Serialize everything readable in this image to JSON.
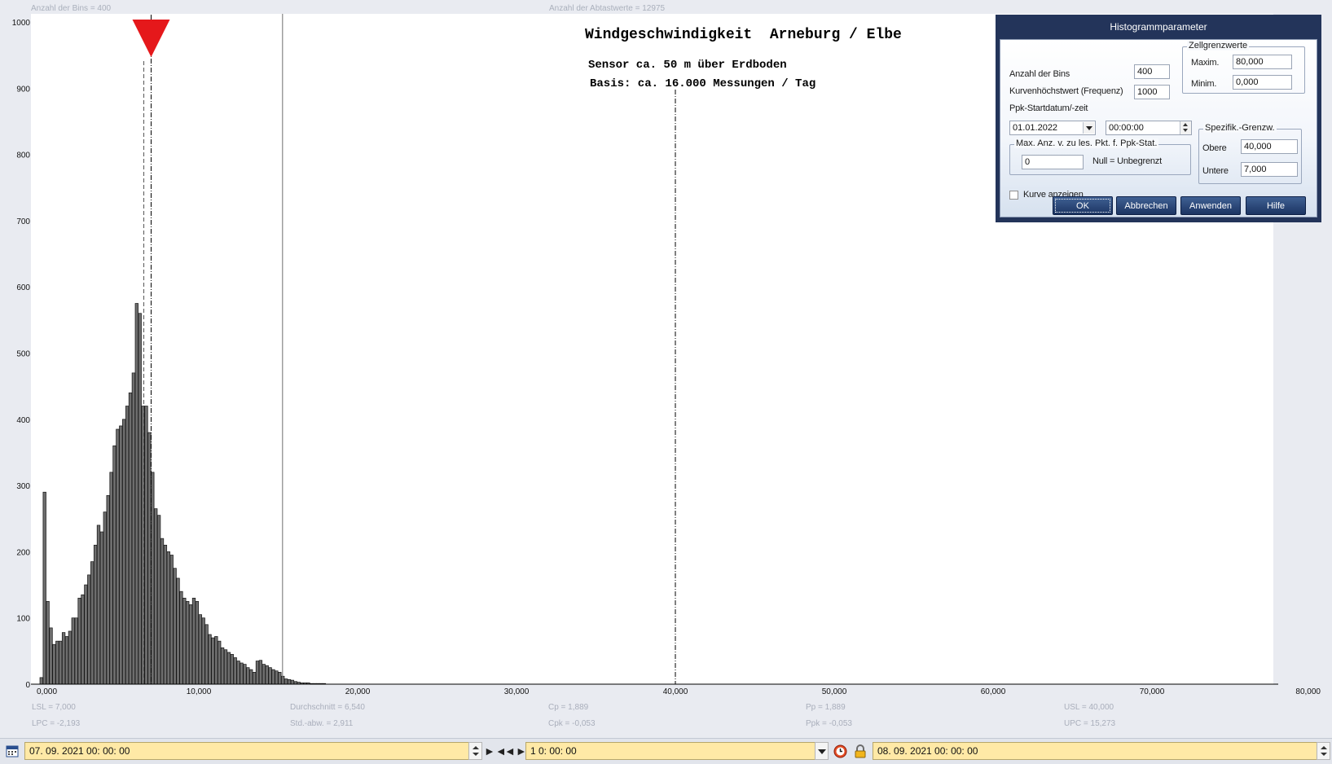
{
  "chart_data": {
    "type": "bar",
    "title": "Windgeschwindigkeit  Arneburg / Elbe",
    "subtitle_lines": [
      "Sensor ca. 50 m über Erdboden",
      "Basis: ca. 16.000 Messungen / Tag"
    ],
    "top_left_info": "Anzahl der Bins =   400",
    "top_center_info": "Anzahl der Abtastwerte = 12975",
    "x_tick_labels": [
      "0,000",
      "10,000",
      "20,000",
      "30,000",
      "40,000",
      "50,000",
      "60,000",
      "70,000",
      "80,000"
    ],
    "x_tick_values": [
      0,
      10,
      20,
      30,
      40,
      50,
      60,
      70,
      80
    ],
    "y_tick_labels": [
      "0",
      "100",
      "200",
      "300",
      "400",
      "500",
      "600",
      "700",
      "800",
      "900",
      "1000"
    ],
    "y_tick_values": [
      0,
      100,
      200,
      300,
      400,
      500,
      600,
      700,
      800,
      900,
      1000
    ],
    "xlim": [
      0,
      80
    ],
    "ylim": [
      0,
      1000
    ],
    "bin_width": 0.2,
    "bin_starts": [
      0.0,
      0.2,
      0.4,
      0.6,
      0.8,
      1.0,
      1.2,
      1.4,
      1.6,
      1.8,
      2.0,
      2.2,
      2.4,
      2.6,
      2.8,
      3.0,
      3.2,
      3.4,
      3.6,
      3.8,
      4.0,
      4.2,
      4.4,
      4.6,
      4.8,
      5.0,
      5.2,
      5.4,
      5.6,
      5.8,
      6.0,
      6.2,
      6.4,
      6.6,
      6.8,
      7.0,
      7.2,
      7.4,
      7.6,
      7.8,
      8.0,
      8.2,
      8.4,
      8.6,
      8.8,
      9.0,
      9.2,
      9.4,
      9.6,
      9.8,
      10.0,
      10.2,
      10.4,
      10.6,
      10.8,
      11.0,
      11.2,
      11.4,
      11.6,
      11.8,
      12.0,
      12.2,
      12.4,
      12.6,
      12.8,
      13.0,
      13.2,
      13.4,
      13.6,
      13.8,
      14.0,
      14.2,
      14.4,
      14.6,
      14.8,
      15.0,
      15.2,
      15.4,
      15.6,
      15.8,
      16.0,
      16.2,
      16.4,
      16.6,
      16.8,
      17.0,
      17.2,
      17.4,
      17.6,
      17.8
    ],
    "values": [
      10,
      290,
      125,
      85,
      60,
      65,
      65,
      78,
      72,
      80,
      100,
      100,
      130,
      135,
      150,
      165,
      185,
      210,
      240,
      230,
      260,
      285,
      320,
      360,
      385,
      390,
      400,
      420,
      440,
      470,
      575,
      560,
      420,
      420,
      380,
      320,
      265,
      255,
      220,
      210,
      200,
      195,
      175,
      160,
      140,
      130,
      125,
      120,
      130,
      125,
      105,
      100,
      90,
      75,
      70,
      72,
      65,
      55,
      52,
      48,
      45,
      40,
      35,
      32,
      30,
      25,
      22,
      18,
      35,
      36,
      30,
      28,
      25,
      22,
      20,
      18,
      12,
      8,
      7,
      6,
      4,
      3,
      2,
      2,
      2,
      1,
      1,
      1,
      1,
      1
    ],
    "mean": 6.54,
    "lsl": 7.0,
    "usl": 40.0,
    "lpc": -2.193,
    "upc": 15.273,
    "grid": false,
    "colors": {
      "bar_fill": "#6e6e6e",
      "bar_edge": "#111111",
      "marker": "#e5181b"
    }
  },
  "stats": {
    "lsl": "LSL = 7,000",
    "lpc": "LPC = -2,193",
    "mean": "Durchschnitt  = 6,540",
    "std": "Std.-abw.  = 2,911",
    "cp": "Cp  = 1,889",
    "cpk": "Cpk = -0,053",
    "pp": "Pp  = 1,889",
    "ppk": "Ppk = -0,053",
    "usl": "USL = 40,000",
    "upc": "UPC = 15,273"
  },
  "dialog": {
    "title": "Histogrammparameter",
    "bins_label": "Anzahl der Bins",
    "bins_value": "400",
    "peak_label": "Kurvenhöchstwert (Frequenz)",
    "peak_value": "1000",
    "start_label": "Ppk-Startdatum/-zeit",
    "start_date": "01.01.2022",
    "start_time": "00:00:00",
    "cell_group": "Zellgrenzwerte",
    "max_label": "Maxim.",
    "max_value": "80,000",
    "min_label": "Minim.",
    "min_value": "0,000",
    "spec_group": "Spezifik.-Grenzw.",
    "upper_label": "Obere",
    "upper_value": "40,000",
    "lower_label": "Untere",
    "lower_value": "7,000",
    "maxpts_group": "Max. Anz. v. zu les. Pkt. f. Ppk-Stat.",
    "maxpts_value": "0",
    "maxpts_hint": "Null = Unbegrenzt",
    "curve_label": "Kurve anzeigen",
    "buttons": {
      "ok": "OK",
      "cancel": "Abbrechen",
      "apply": "Anwenden",
      "help": "Hilfe"
    }
  },
  "bottom_bar": {
    "start": "07. 09. 2021    00: 00: 00",
    "interval": "1  0: 00: 00",
    "end": "08. 09. 2021    00: 00: 00"
  },
  "icons": [
    "calendar-icon",
    "shrink-arrows-icon",
    "expand-arrows-icon",
    "clock-icon",
    "lock-icon"
  ]
}
